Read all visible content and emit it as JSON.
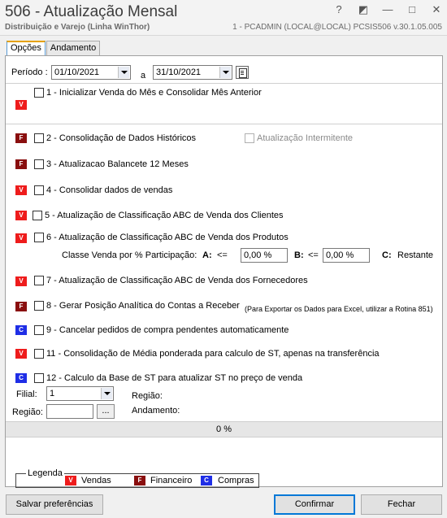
{
  "window": {
    "title": "506 - Atualização Mensal",
    "subtitle": "Distribuição e Varejo (Linha WinThor)",
    "session": "1 - PCADMIN (LOCAL@LOCAL)   PCSIS506  v.30.1.05.005",
    "controls": [
      "?",
      "◩",
      "—",
      "□",
      "✕"
    ]
  },
  "tabs": [
    {
      "label": "Opções",
      "active": true
    },
    {
      "label": "Andamento",
      "active": false
    }
  ],
  "period": {
    "label": "Período :",
    "start": "01/10/2021",
    "separator": "a",
    "end": "31/10/2021"
  },
  "badges": {
    "v": "V",
    "f": "F",
    "c": "C"
  },
  "options": [
    {
      "badge": "V",
      "label": "1 - Inicializar Venda do Mês e Consolidar Mês Anterior",
      "checked": false
    },
    {
      "badge": "F",
      "label": "2 - Consolidação de Dados Históricos",
      "checked": false
    },
    {
      "badge": "F",
      "label": "3 - Atualizacao Balancete 12 Meses",
      "checked": false
    },
    {
      "badge": "V",
      "label": "4 - Consolidar dados de vendas",
      "checked": false
    },
    {
      "badge": "V",
      "label": "5 - Atualização de Classificação ABC de Venda dos Clientes",
      "checked": false
    },
    {
      "badge": "V",
      "label": "6 - Atualização de Classificação ABC de Venda dos Produtos",
      "checked": false
    },
    {
      "badge": "V",
      "label": "7 - Atualização de Classificação ABC de Venda dos Fornecedores",
      "checked": false
    },
    {
      "badge": "F",
      "label": "8 - Gerar  Posição Analítica do Contas a Receber",
      "checked": false
    },
    {
      "badge": "C",
      "label": "9 - Cancelar pedidos de compra pendentes automaticamente",
      "checked": false
    },
    {
      "badge": "V",
      "label": "11 - Consolidação de Média ponderada para calculo de ST, apenas na transferência",
      "checked": false
    },
    {
      "badge": "C",
      "label": "12 - Calculo da Base de ST para atualizar ST no preço de venda",
      "checked": false
    }
  ],
  "intermitente": {
    "label": "Atualização Intermitente",
    "checked": false,
    "enabled": false
  },
  "classe": {
    "label": "Classe Venda por % Participação:",
    "a_label": "A:",
    "a_op": "<=",
    "a_value": "0,00 %",
    "b_label": "B:",
    "b_op": "<=",
    "b_value": "0,00 %",
    "c_label": "C:",
    "c_text": "Restante"
  },
  "note8": "(Para Exportar os Dados para Excel, utilizar a Rotina 851)",
  "filial": {
    "label": "Filial:",
    "value": "1"
  },
  "regiao": {
    "label": "Região:",
    "value": "",
    "btn": "..."
  },
  "regiao_info": {
    "label": "Região:"
  },
  "andamento": {
    "label": "Andamento:"
  },
  "progress": {
    "text": "0 %",
    "value": 0
  },
  "legend": {
    "title": "Legenda",
    "items": [
      {
        "badge": "V",
        "label": "Vendas"
      },
      {
        "badge": "F",
        "label": "Financeiro"
      },
      {
        "badge": "C",
        "label": "Compras"
      }
    ]
  },
  "buttons": {
    "save": "Salvar preferências",
    "confirm": "Confirmar",
    "close": "Fechar"
  },
  "colors": {
    "vendas": "#ee1c1c",
    "financeiro": "#8a0f0f",
    "compras": "#1f2ee6",
    "accent": "#0078d7"
  }
}
